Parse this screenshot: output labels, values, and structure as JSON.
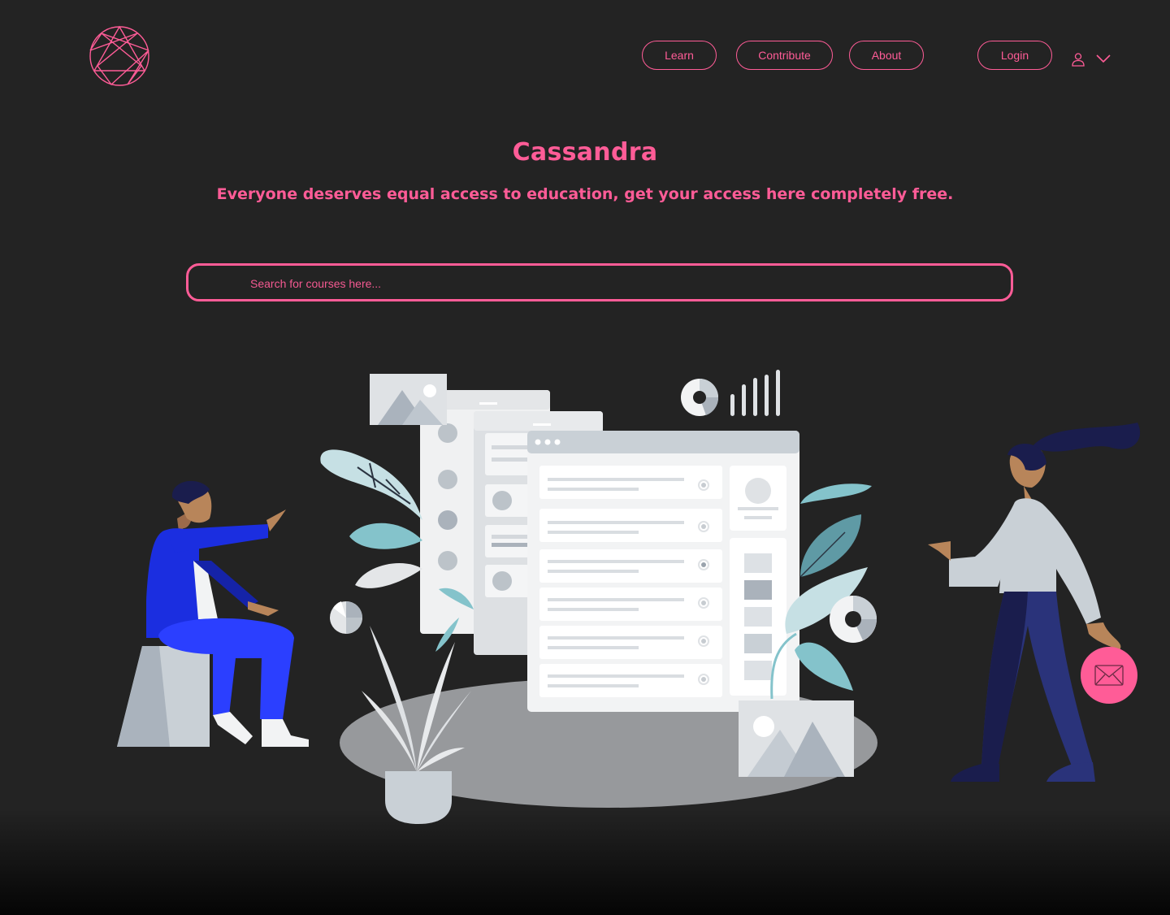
{
  "nav": {
    "learn_label": "Learn",
    "contribute_label": "Contribute",
    "about_label": "About",
    "login_label": "Login"
  },
  "hero": {
    "title": "Cassandra",
    "subtitle": "Everyone deserves equal access to education, get your access here completely free."
  },
  "search": {
    "placeholder": "Search for courses here..."
  },
  "icons": {
    "logo": "enneagram-logo-icon",
    "user": "user-icon",
    "account_menu": "chevron-down-icon",
    "contact": "mail-icon"
  },
  "colors": {
    "accent": "#ff5c97",
    "background": "#232323"
  }
}
